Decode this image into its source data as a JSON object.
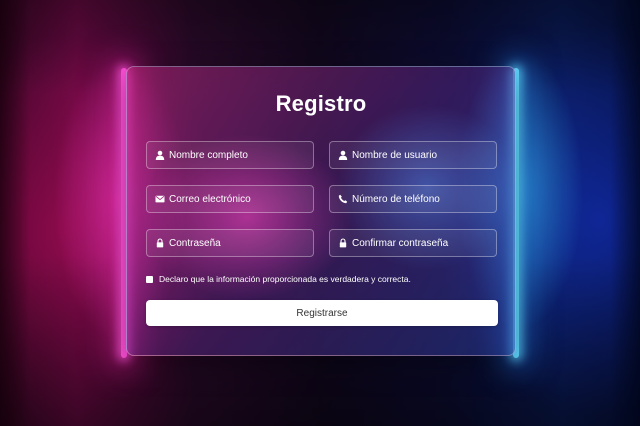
{
  "form": {
    "title": "Registro",
    "fields": [
      {
        "icon": "user-icon",
        "placeholder": "Nombre completo"
      },
      {
        "icon": "user-icon",
        "placeholder": "Nombre de usuario"
      },
      {
        "icon": "envelope-icon",
        "placeholder": "Correo electrónico"
      },
      {
        "icon": "phone-icon",
        "placeholder": "Número de teléfono"
      },
      {
        "icon": "lock-icon",
        "placeholder": "Contraseña"
      },
      {
        "icon": "lock-icon",
        "placeholder": "Confirmar contraseña"
      }
    ],
    "declaration": "Declaro que la información proporcionada es verdadera y correcta.",
    "declaration_checked": false,
    "submit_label": "Registrarse"
  },
  "colors": {
    "neon_left": "#ff4fd8",
    "neon_right": "#5fd6ff",
    "button_bg": "#ffffff",
    "button_text": "#333333",
    "text": "#ffffff"
  }
}
